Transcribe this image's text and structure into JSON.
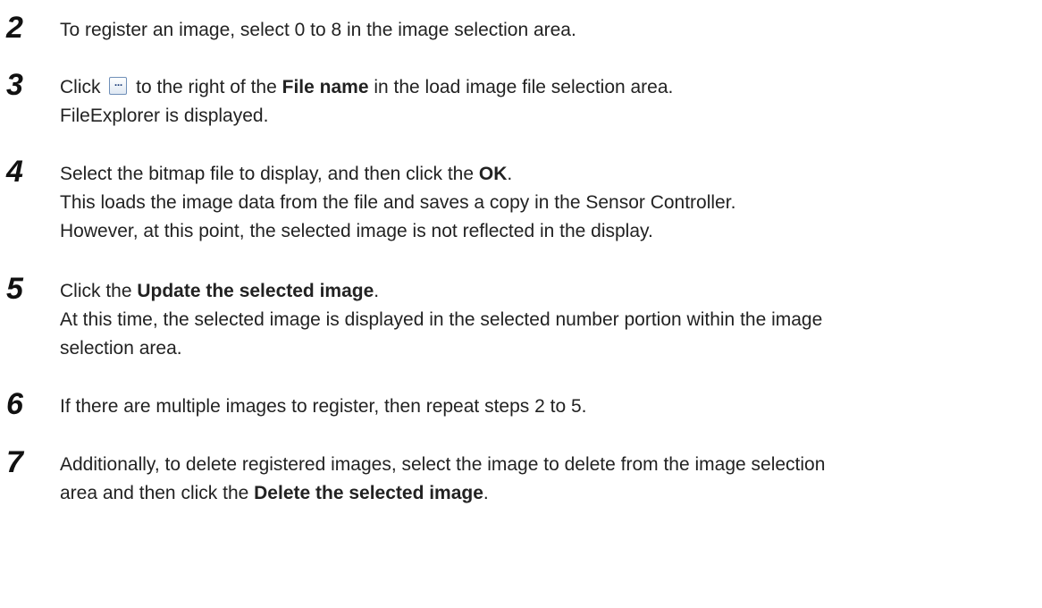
{
  "steps": [
    {
      "number": "2",
      "lines": [
        {
          "t1": "To register an image, select 0 to 8 in the image selection area."
        }
      ]
    },
    {
      "number": "3",
      "lines": [
        {
          "t1": "Click ",
          "icon": "ellipsis-browse-icon",
          "t2": " to the right of the ",
          "b1": "File name",
          "t3": " in the load image file selection area."
        },
        {
          "t1": "FileExplorer is displayed."
        }
      ]
    },
    {
      "number": "4",
      "lines": [
        {
          "t1": "Select the bitmap file to display, and then click the ",
          "b1": "OK",
          "t2": "."
        },
        {
          "t1": "This loads the image data from the file and saves a copy in the Sensor Controller."
        },
        {
          "t1": "However, at this point, the selected image is not reflected in the display."
        }
      ]
    },
    {
      "number": "5",
      "lines": [
        {
          "t1": "Click the ",
          "b1": "Update the selected image",
          "t2": "."
        },
        {
          "t1": "At this time, the selected image is displayed in the selected number portion within the image"
        },
        {
          "t1": "selection area."
        }
      ]
    },
    {
      "number": "6",
      "lines": [
        {
          "t1": "If there are multiple images to register, then repeat steps 2 to 5."
        }
      ]
    },
    {
      "number": "7",
      "lines": [
        {
          "t1": "Additionally, to delete registered images, select the image to delete from the image selection"
        },
        {
          "t1": "area and then click the ",
          "b1": "Delete the selected image",
          "t2": "."
        }
      ]
    }
  ]
}
